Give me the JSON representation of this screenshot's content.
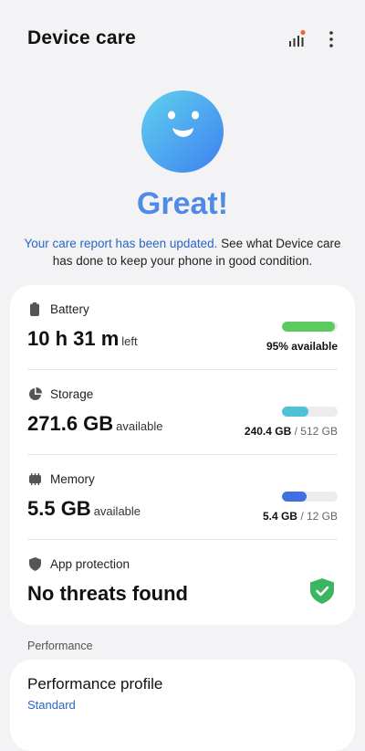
{
  "header": {
    "title": "Device care",
    "stats_icon": "bar-chart-icon",
    "more_icon": "more-vertical-icon"
  },
  "hero": {
    "face_icon": "smiley-face-icon",
    "status": "Great!",
    "report_link": "Your care report has been updated.",
    "report_text": " See what Device care has done to keep your phone in good condition."
  },
  "items": {
    "battery": {
      "label": "Battery",
      "value": "10 h 31 m",
      "suffix": "left",
      "caption": "95% available",
      "fill_percent": 95,
      "color": "#5ccb5f"
    },
    "storage": {
      "label": "Storage",
      "value": "271.6 GB",
      "suffix": "available",
      "used": "240.4 GB",
      "total": "/ 512 GB",
      "fill_percent": 47,
      "color": "#4fc1d8"
    },
    "memory": {
      "label": "Memory",
      "value": "5.5 GB",
      "suffix": "available",
      "used": "5.4 GB",
      "total": "/ 12 GB",
      "fill_percent": 45,
      "color": "#3f6fe0"
    },
    "protection": {
      "label": "App protection",
      "value": "No threats found",
      "status_icon": "shield-check-icon",
      "color": "#3bb560"
    }
  },
  "performance": {
    "section": "Performance",
    "title": "Performance profile",
    "subtitle": "Standard"
  },
  "colors": {
    "accent": "#4f8be6",
    "link": "#2a66c9"
  }
}
